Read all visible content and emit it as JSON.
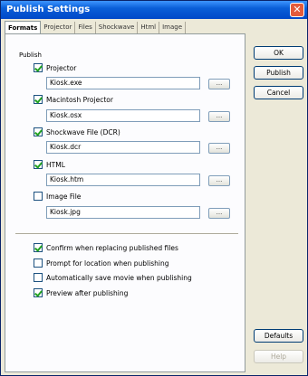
{
  "window": {
    "title": "Publish Settings",
    "close_glyph": "✕"
  },
  "tabs": [
    "Formats",
    "Projector",
    "Files",
    "Shockwave",
    "Html",
    "Image"
  ],
  "publish": {
    "label": "Publish",
    "items": [
      {
        "label": "Projector",
        "checked": true,
        "value": "Kiosk.exe"
      },
      {
        "label": "Macintosh Projector",
        "checked": true,
        "value": "Kiosk.osx"
      },
      {
        "label": "Shockwave File (DCR)",
        "checked": true,
        "value": "Kiosk.dcr"
      },
      {
        "label": "HTML",
        "checked": true,
        "value": "Kiosk.htm"
      },
      {
        "label": "Image File",
        "checked": false,
        "value": "Kiosk.jpg"
      }
    ],
    "browse_label": "..."
  },
  "options": [
    {
      "label": "Confirm when replacing published files",
      "checked": true
    },
    {
      "label": "Prompt for location when publishing",
      "checked": false
    },
    {
      "label": "Automatically save movie when publishing",
      "checked": false
    },
    {
      "label": "Preview after publishing",
      "checked": true
    }
  ],
  "buttons": {
    "ok": "OK",
    "publish": "Publish",
    "cancel": "Cancel",
    "defaults": "Defaults",
    "help": "Help"
  }
}
